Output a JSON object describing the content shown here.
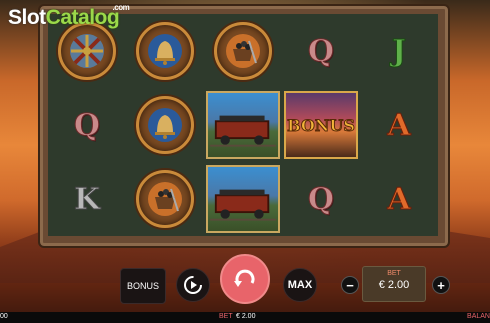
{
  "watermark": {
    "slot": "Slot",
    "catalog": "Catalog",
    "com": ".com"
  },
  "reels": [
    [
      "wheel",
      "bell",
      "ore-cart"
    ],
    [
      "Q",
      "bell",
      "train"
    ],
    [
      "K",
      "ore-cart",
      "train"
    ],
    [
      "Q",
      "BONUS",
      "Q"
    ],
    [
      "J",
      "A",
      "A"
    ]
  ],
  "symbols": {
    "q": "Q",
    "j": "J",
    "a": "A",
    "k": "K",
    "bonus": "BONUS"
  },
  "controls": {
    "bonus_label": "BONUS",
    "max_label": "MAX",
    "minus_label": "−",
    "plus_label": "+",
    "bet_label": "BET",
    "bet_value": "€ 2.00"
  },
  "statusbar": {
    "left_text": "00",
    "bet_label": "BET",
    "bet_value": "€ 2.00",
    "balance_label": "BALAN"
  },
  "colors": {
    "spin": "#e8646a",
    "frame": "#6a4a33",
    "accent": "#f08a6a"
  }
}
